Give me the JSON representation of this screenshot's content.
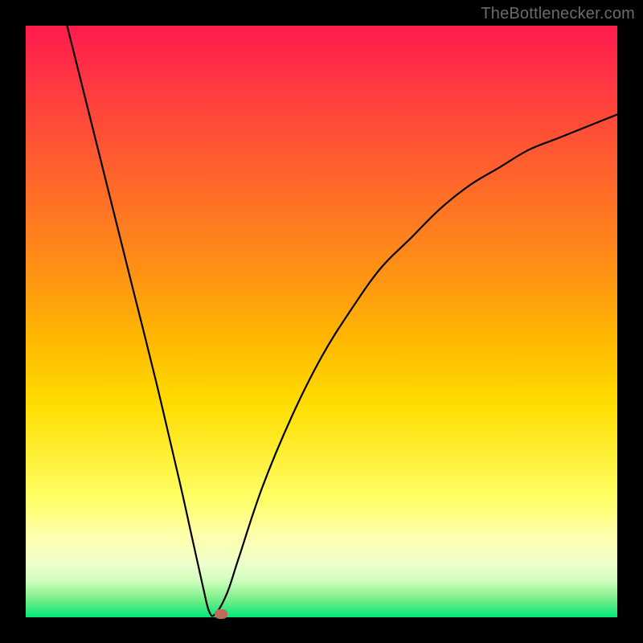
{
  "watermark": {
    "text": "TheBottlenecker.com"
  },
  "chart_data": {
    "type": "line",
    "title": "",
    "xlabel": "",
    "ylabel": "",
    "xlim": [
      0,
      100
    ],
    "ylim": [
      0,
      100
    ],
    "grid": false,
    "legend": false,
    "series": [
      {
        "name": "curve",
        "color": "#000000",
        "x": [
          7,
          10,
          14,
          18,
          22,
          26,
          28,
          30,
          31,
          32,
          34,
          36,
          40,
          45,
          50,
          55,
          60,
          65,
          70,
          75,
          80,
          85,
          90,
          95,
          100
        ],
        "y": [
          100,
          88,
          72,
          56,
          40,
          23,
          14,
          5,
          1,
          0.5,
          4,
          10,
          22,
          34,
          44,
          52,
          59,
          64,
          69,
          73,
          76,
          79,
          81,
          83,
          85
        ]
      }
    ],
    "marker": {
      "x": 33,
      "y": 0.5,
      "color": "#c26a5a"
    },
    "background": {
      "type": "vertical-gradient",
      "stops": [
        {
          "pos": 0.0,
          "color": "#ff1a4d"
        },
        {
          "pos": 0.5,
          "color": "#ffbb00"
        },
        {
          "pos": 0.85,
          "color": "#ffffaa"
        },
        {
          "pos": 1.0,
          "color": "#00e87a"
        }
      ]
    }
  }
}
